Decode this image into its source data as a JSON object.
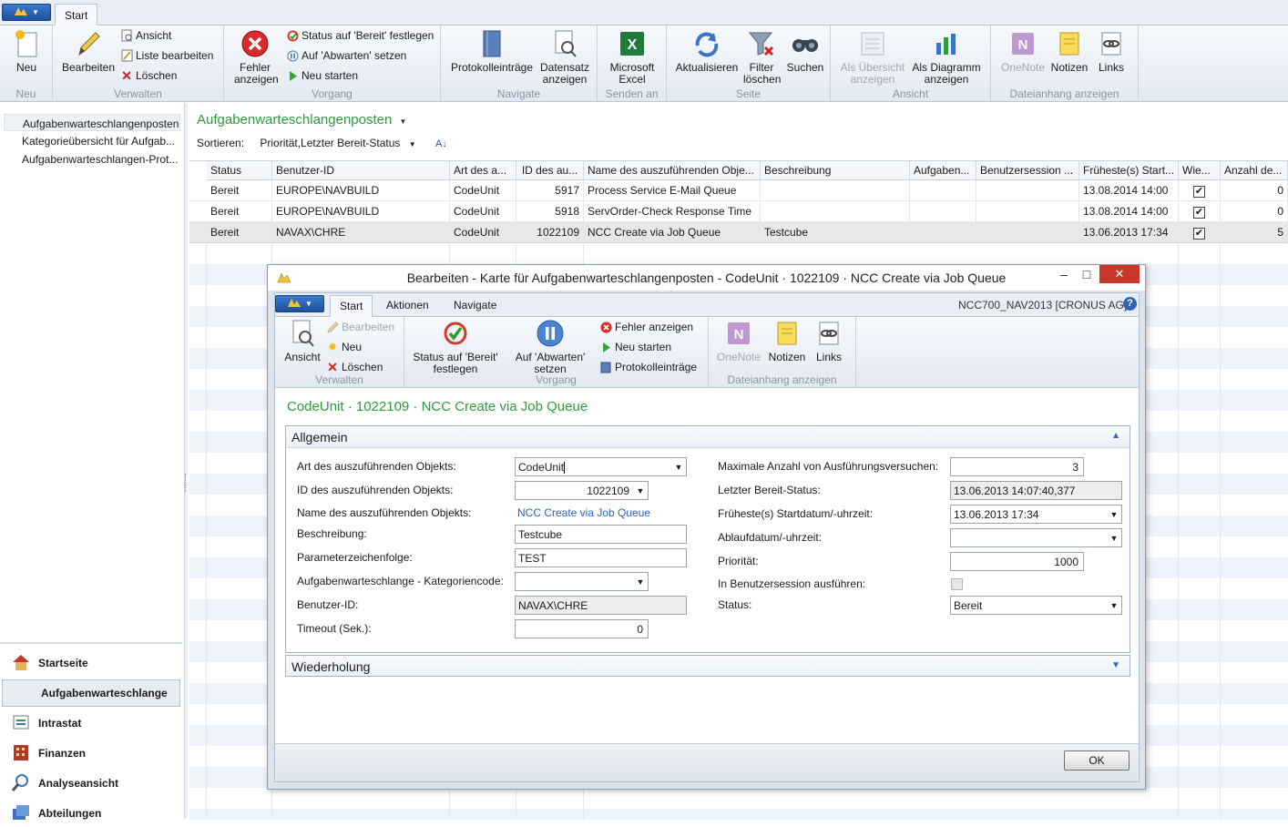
{
  "tabs": {
    "start": "Start"
  },
  "ribbon": {
    "groups": {
      "neu": "Neu",
      "verwalten": "Verwalten",
      "vorgang": "Vorgang",
      "navigate": "Navigate",
      "senden": "Senden an",
      "seite": "Seite",
      "ansicht": "Ansicht",
      "dateianhang": "Dateianhang anzeigen"
    },
    "buttons": {
      "neu": "Neu",
      "bearbeiten": "Bearbeiten",
      "ansicht": "Ansicht",
      "liste_bearbeiten": "Liste bearbeiten",
      "loeschen": "Löschen",
      "fehler_anzeigen": "Fehler anzeigen",
      "status_bereit": "Status auf 'Bereit' festlegen",
      "auf_abwarten": "Auf 'Abwarten' setzen",
      "neu_starten": "Neu starten",
      "protokolleintraege": "Protokolleinträge",
      "datensatz_anzeigen": "Datensatz anzeigen",
      "excel": "Microsoft Excel",
      "aktualisieren": "Aktualisieren",
      "filter_loeschen": "Filter löschen",
      "suchen": "Suchen",
      "als_uebersicht": "Als Übersicht anzeigen",
      "als_diagramm": "Als Diagramm anzeigen",
      "onenote": "OneNote",
      "notizen": "Notizen",
      "links": "Links"
    }
  },
  "nav": {
    "links": [
      "Aufgabenwarteschlangenposten",
      "Kategorieübersicht für Aufgab...",
      "Aufgabenwarteschlangen-Prot..."
    ],
    "sections": [
      "Startseite",
      "Aufgabenwarteschlange",
      "Intrastat",
      "Finanzen",
      "Analyseansicht",
      "Abteilungen"
    ]
  },
  "page": {
    "title": "Aufgabenwarteschlangenposten",
    "sort_label": "Sortieren:",
    "sort_value": "Priorität,Letzter Bereit-Status"
  },
  "table": {
    "columns": [
      "Status",
      "Benutzer-ID",
      "Art des a...",
      "ID des au...",
      "Name des auszuführenden Obje...",
      "Beschreibung",
      "Aufgaben...",
      "Benutzersession ...",
      "Früheste(s) Start...",
      "Wie...",
      "Anzahl de..."
    ],
    "rows": [
      {
        "status": "Bereit",
        "user": "EUROPE\\NAVBUILD",
        "art": "CodeUnit",
        "id": "5917",
        "name": "Process Service E-Mail Queue",
        "desc": "",
        "start": "13.08.2014 14:00",
        "checked": true,
        "anzahl": "0"
      },
      {
        "status": "Bereit",
        "user": "EUROPE\\NAVBUILD",
        "art": "CodeUnit",
        "id": "5918",
        "name": "ServOrder-Check Response Time",
        "desc": "",
        "start": "13.08.2014 14:00",
        "checked": true,
        "anzahl": "0"
      },
      {
        "status": "Bereit",
        "user": "NAVAX\\CHRE",
        "art": "CodeUnit",
        "id": "1022109",
        "name": "NCC Create via Job Queue",
        "desc": "Testcube",
        "start": "13.06.2013 17:34",
        "checked": true,
        "anzahl": "5"
      }
    ]
  },
  "dialog": {
    "title": "Bearbeiten - Karte für Aufgabenwarteschlangenposten - CodeUnit · 1022109 · NCC Create via Job Queue",
    "tabs": [
      "Start",
      "Aktionen",
      "Navigate"
    ],
    "company": "NCC700_NAV2013 [CRONUS AG]",
    "ribbon": {
      "ansicht": "Ansicht",
      "bearbeiten": "Bearbeiten",
      "neu": "Neu",
      "loeschen": "Löschen",
      "status_bereit": "Status auf 'Bereit' festlegen",
      "auf_abwarten": "Auf 'Abwarten' setzen",
      "fehler_anzeigen": "Fehler anzeigen",
      "neu_starten": "Neu starten",
      "protokolleintraege": "Protokolleinträge",
      "onenote": "OneNote",
      "notizen": "Notizen",
      "links": "Links",
      "groups": {
        "verwalten": "Verwalten",
        "vorgang": "Vorgang",
        "dateianhang": "Dateianhang anzeigen"
      }
    },
    "heading": "CodeUnit · 1022109 · NCC Create via Job Queue",
    "fasttab_general": "Allgemein",
    "fasttab_recurrence": "Wiederholung",
    "left_fields": [
      {
        "label": "Art des auszuführenden Objekts:",
        "value": "CodeUnit"
      },
      {
        "label": "ID des auszuführenden Objekts:",
        "value": "1022109"
      },
      {
        "label": "Name des auszuführenden Objekts:",
        "value": "NCC Create via Job Queue"
      },
      {
        "label": "Beschreibung:",
        "value": "Testcube"
      },
      {
        "label": "Parameterzeichenfolge:",
        "value": "TEST"
      },
      {
        "label": "Aufgabenwarteschlange - Kategoriencode:",
        "value": ""
      },
      {
        "label": "Benutzer-ID:",
        "value": "NAVAX\\CHRE"
      },
      {
        "label": "Timeout (Sek.):",
        "value": "0"
      }
    ],
    "right_fields": [
      {
        "label": "Maximale Anzahl von Ausführungsversuchen:",
        "value": "3"
      },
      {
        "label": "Letzter Bereit-Status:",
        "value": "13.06.2013 14:07:40,377"
      },
      {
        "label": "Früheste(s) Startdatum/-uhrzeit:",
        "value": "13.06.2013 17:34"
      },
      {
        "label": "Ablaufdatum/-uhrzeit:",
        "value": ""
      },
      {
        "label": "Priorität:",
        "value": "1000"
      },
      {
        "label": "In Benutzersession ausführen:",
        "value": ""
      },
      {
        "label": "Status:",
        "value": "Bereit"
      }
    ],
    "ok": "OK"
  }
}
